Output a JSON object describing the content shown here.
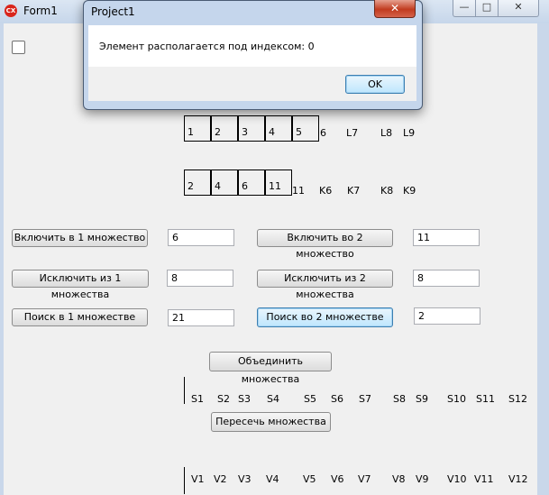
{
  "main_window": {
    "title": "Form1",
    "icon_text": "CX",
    "minimize": "—",
    "maximize": "□",
    "close": "✕"
  },
  "set1_cells": [
    "1",
    "2",
    "3",
    "4",
    "5"
  ],
  "set1_labels": [
    "6",
    "L7",
    "L8",
    "L9"
  ],
  "set2_cells": [
    "2",
    "4",
    "6",
    "11"
  ],
  "set2_labels": [
    "11",
    "K6",
    "K7",
    "K8",
    "K9"
  ],
  "buttons": {
    "include1": "Включить в 1 множество",
    "include2": "Включить во 2 множество",
    "exclude1": "Исключить из 1 множества",
    "exclude2": "Исключить из 2 множества",
    "search1": "Поиск в 1 множестве",
    "search2": "Поиск во 2 множестве",
    "union": "Объединить множества",
    "intersect": "Пересечь множества"
  },
  "inputs": {
    "include1": "6",
    "include2": "11",
    "exclude1": "8",
    "exclude2": "8",
    "search1": "21",
    "search2": "2"
  },
  "union_labels": [
    "S1",
    "S2",
    "S3",
    "S4",
    "S5",
    "S6",
    "S7",
    "S8",
    "S9",
    "S10",
    "S11",
    "S12"
  ],
  "intersect_labels": [
    "V1",
    "V2",
    "V3",
    "V4",
    "V5",
    "V6",
    "V7",
    "V8",
    "V9",
    "V10",
    "V11",
    "V12"
  ],
  "dialog": {
    "title": "Project1",
    "close": "✕",
    "message": "Элемент располагается под индексом: 0",
    "ok": "OK"
  }
}
